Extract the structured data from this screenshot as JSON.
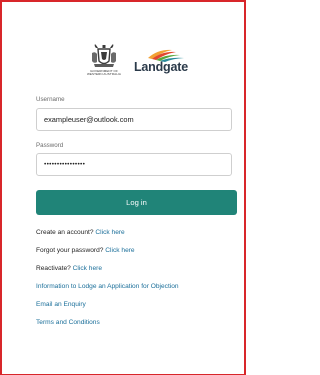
{
  "logos": {
    "government_lines": [
      "GOVERNMENT OF",
      "WESTERN AUSTRALIA"
    ],
    "landgate_name": "Landgate",
    "brand_colors": {
      "landgate_orange": "#f2a134",
      "landgate_red": "#e2472f",
      "landgate_green": "#5aa63a",
      "landgate_teal": "#2a8b9c"
    }
  },
  "form": {
    "username_label": "Username",
    "username_value": "exampleuser@outlook.com",
    "password_label": "Password",
    "password_value": "••••••••••••••••",
    "login_label": "Log in",
    "accent_color": "#208478"
  },
  "links": {
    "create_prefix": "Create an account?",
    "create_link": "Click here",
    "forgot_prefix": "Forgot your password?",
    "forgot_link": "Click here",
    "reactivate_prefix": "Reactivate?",
    "reactivate_link": "Click here",
    "lodge_objection": "Information to Lodge an Application for Objection",
    "email_enquiry": "Email an Enquiry",
    "terms": "Terms and Conditions"
  }
}
